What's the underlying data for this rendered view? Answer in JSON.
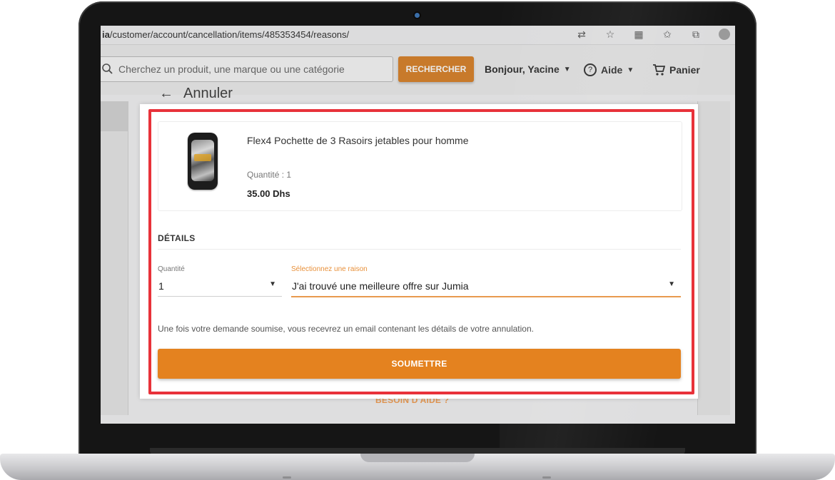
{
  "browser": {
    "url_bold": "ia",
    "url_rest": "/customer/account/cancellation/items/485353454/reasons/"
  },
  "header": {
    "search_placeholder": "Cherchez un produit, une marque ou une catégorie",
    "search_button": "RECHERCHER",
    "greeting": "Bonjour, Yacine",
    "help": "Aide",
    "cart": "Panier"
  },
  "page": {
    "back_title": "Annuler",
    "help_link": "BESOIN D'AIDE ?"
  },
  "product": {
    "name": "Flex4 Pochette de 3 Rasoirs jetables pour homme",
    "quantity_text": "Quantité : 1",
    "price": "35.00 Dhs"
  },
  "form": {
    "details_heading": "DÉTAILS",
    "quantity_label": "Quantité",
    "quantity_value": "1",
    "reason_label": "Sélectionnez une raison",
    "reason_value": "J'ai trouvé une meilleure offre sur Jumia",
    "info": "Une fois votre demande soumise, vous recevrez un email contenant les détails de votre annulation.",
    "submit": "SOUMETTRE"
  },
  "colors": {
    "accent": "#e4821f",
    "highlight": "#e8323a",
    "label_active": "#e8903a"
  }
}
